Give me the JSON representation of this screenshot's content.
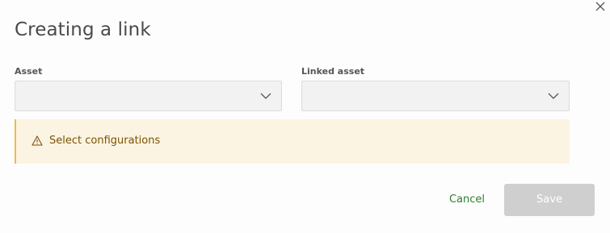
{
  "dialog": {
    "title": "Creating a link",
    "close_icon": "close-icon"
  },
  "fields": {
    "asset": {
      "label": "Asset",
      "value": "",
      "icon": "chevron-down-icon"
    },
    "linked_asset": {
      "label": "Linked asset",
      "value": "",
      "icon": "chevron-down-icon"
    }
  },
  "warning": {
    "icon": "warning-icon",
    "text": "Select configurations"
  },
  "actions": {
    "cancel_label": "Cancel",
    "save_label": "Save",
    "save_disabled": true
  },
  "colors": {
    "accent_green": "#2e7d32",
    "warning_border": "#f2b94a",
    "warning_bg": "#fcf4e3",
    "disabled_button": "#cfcfd0"
  }
}
